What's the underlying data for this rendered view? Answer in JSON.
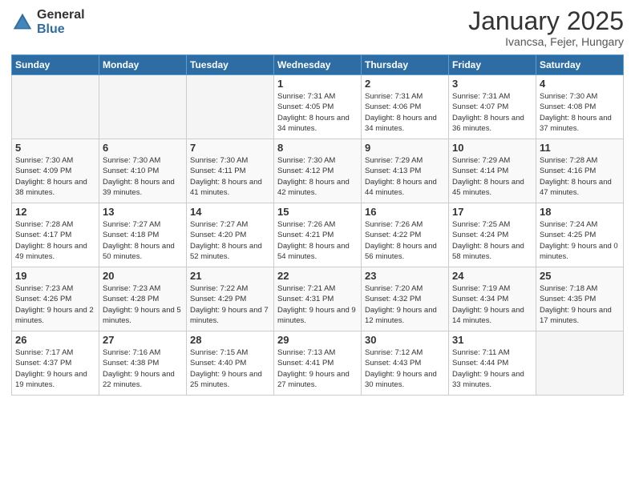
{
  "header": {
    "logo_general": "General",
    "logo_blue": "Blue",
    "month_title": "January 2025",
    "location": "Ivancsa, Fejer, Hungary"
  },
  "days_of_week": [
    "Sunday",
    "Monday",
    "Tuesday",
    "Wednesday",
    "Thursday",
    "Friday",
    "Saturday"
  ],
  "weeks": [
    [
      {
        "day": "",
        "info": ""
      },
      {
        "day": "",
        "info": ""
      },
      {
        "day": "",
        "info": ""
      },
      {
        "day": "1",
        "info": "Sunrise: 7:31 AM\nSunset: 4:05 PM\nDaylight: 8 hours\nand 34 minutes."
      },
      {
        "day": "2",
        "info": "Sunrise: 7:31 AM\nSunset: 4:06 PM\nDaylight: 8 hours\nand 34 minutes."
      },
      {
        "day": "3",
        "info": "Sunrise: 7:31 AM\nSunset: 4:07 PM\nDaylight: 8 hours\nand 36 minutes."
      },
      {
        "day": "4",
        "info": "Sunrise: 7:30 AM\nSunset: 4:08 PM\nDaylight: 8 hours\nand 37 minutes."
      }
    ],
    [
      {
        "day": "5",
        "info": "Sunrise: 7:30 AM\nSunset: 4:09 PM\nDaylight: 8 hours\nand 38 minutes."
      },
      {
        "day": "6",
        "info": "Sunrise: 7:30 AM\nSunset: 4:10 PM\nDaylight: 8 hours\nand 39 minutes."
      },
      {
        "day": "7",
        "info": "Sunrise: 7:30 AM\nSunset: 4:11 PM\nDaylight: 8 hours\nand 41 minutes."
      },
      {
        "day": "8",
        "info": "Sunrise: 7:30 AM\nSunset: 4:12 PM\nDaylight: 8 hours\nand 42 minutes."
      },
      {
        "day": "9",
        "info": "Sunrise: 7:29 AM\nSunset: 4:13 PM\nDaylight: 8 hours\nand 44 minutes."
      },
      {
        "day": "10",
        "info": "Sunrise: 7:29 AM\nSunset: 4:14 PM\nDaylight: 8 hours\nand 45 minutes."
      },
      {
        "day": "11",
        "info": "Sunrise: 7:28 AM\nSunset: 4:16 PM\nDaylight: 8 hours\nand 47 minutes."
      }
    ],
    [
      {
        "day": "12",
        "info": "Sunrise: 7:28 AM\nSunset: 4:17 PM\nDaylight: 8 hours\nand 49 minutes."
      },
      {
        "day": "13",
        "info": "Sunrise: 7:27 AM\nSunset: 4:18 PM\nDaylight: 8 hours\nand 50 minutes."
      },
      {
        "day": "14",
        "info": "Sunrise: 7:27 AM\nSunset: 4:20 PM\nDaylight: 8 hours\nand 52 minutes."
      },
      {
        "day": "15",
        "info": "Sunrise: 7:26 AM\nSunset: 4:21 PM\nDaylight: 8 hours\nand 54 minutes."
      },
      {
        "day": "16",
        "info": "Sunrise: 7:26 AM\nSunset: 4:22 PM\nDaylight: 8 hours\nand 56 minutes."
      },
      {
        "day": "17",
        "info": "Sunrise: 7:25 AM\nSunset: 4:24 PM\nDaylight: 8 hours\nand 58 minutes."
      },
      {
        "day": "18",
        "info": "Sunrise: 7:24 AM\nSunset: 4:25 PM\nDaylight: 9 hours\nand 0 minutes."
      }
    ],
    [
      {
        "day": "19",
        "info": "Sunrise: 7:23 AM\nSunset: 4:26 PM\nDaylight: 9 hours\nand 2 minutes."
      },
      {
        "day": "20",
        "info": "Sunrise: 7:23 AM\nSunset: 4:28 PM\nDaylight: 9 hours\nand 5 minutes."
      },
      {
        "day": "21",
        "info": "Sunrise: 7:22 AM\nSunset: 4:29 PM\nDaylight: 9 hours\nand 7 minutes."
      },
      {
        "day": "22",
        "info": "Sunrise: 7:21 AM\nSunset: 4:31 PM\nDaylight: 9 hours\nand 9 minutes."
      },
      {
        "day": "23",
        "info": "Sunrise: 7:20 AM\nSunset: 4:32 PM\nDaylight: 9 hours\nand 12 minutes."
      },
      {
        "day": "24",
        "info": "Sunrise: 7:19 AM\nSunset: 4:34 PM\nDaylight: 9 hours\nand 14 minutes."
      },
      {
        "day": "25",
        "info": "Sunrise: 7:18 AM\nSunset: 4:35 PM\nDaylight: 9 hours\nand 17 minutes."
      }
    ],
    [
      {
        "day": "26",
        "info": "Sunrise: 7:17 AM\nSunset: 4:37 PM\nDaylight: 9 hours\nand 19 minutes."
      },
      {
        "day": "27",
        "info": "Sunrise: 7:16 AM\nSunset: 4:38 PM\nDaylight: 9 hours\nand 22 minutes."
      },
      {
        "day": "28",
        "info": "Sunrise: 7:15 AM\nSunset: 4:40 PM\nDaylight: 9 hours\nand 25 minutes."
      },
      {
        "day": "29",
        "info": "Sunrise: 7:13 AM\nSunset: 4:41 PM\nDaylight: 9 hours\nand 27 minutes."
      },
      {
        "day": "30",
        "info": "Sunrise: 7:12 AM\nSunset: 4:43 PM\nDaylight: 9 hours\nand 30 minutes."
      },
      {
        "day": "31",
        "info": "Sunrise: 7:11 AM\nSunset: 4:44 PM\nDaylight: 9 hours\nand 33 minutes."
      },
      {
        "day": "",
        "info": ""
      }
    ]
  ]
}
